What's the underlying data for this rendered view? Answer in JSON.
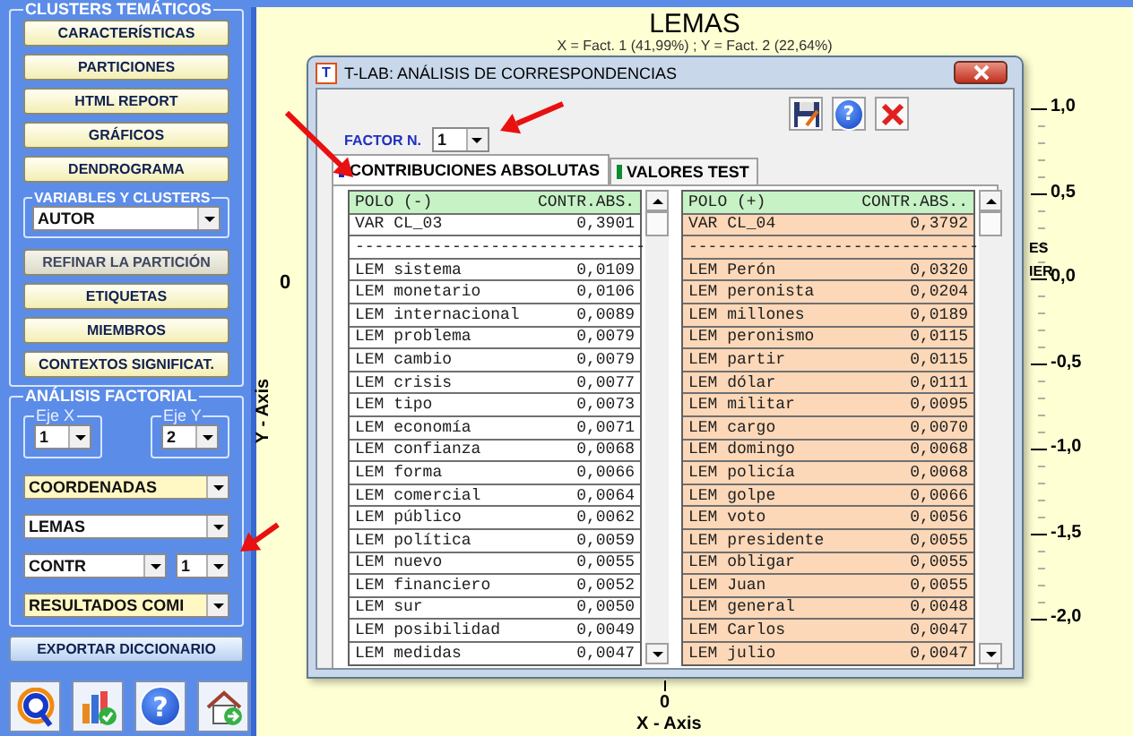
{
  "sidebar": {
    "clusters_group": {
      "title": "CLUSTERS TEMÁTICOS",
      "buttons": [
        {
          "label": "CARACTERÍSTICAS",
          "disabled": false
        },
        {
          "label": "PARTICIONES",
          "disabled": false
        },
        {
          "label": "HTML REPORT",
          "disabled": false
        },
        {
          "label": "GRÁFICOS",
          "disabled": false
        },
        {
          "label": "DENDROGRAMA",
          "disabled": false
        }
      ],
      "variables_group": {
        "title": "VARIABLES Y CLUSTERS",
        "value": "AUTOR"
      },
      "more_buttons": [
        {
          "label": "REFINAR LA PARTICIÓN",
          "disabled": true
        },
        {
          "label": "ETIQUETAS",
          "disabled": false
        },
        {
          "label": "MIEMBROS",
          "disabled": false
        },
        {
          "label": "CONTEXTOS SIGNIFICAT.",
          "disabled": false
        }
      ]
    },
    "factorial_group": {
      "title": "ANÁLISIS FACTORIAL",
      "axes": [
        {
          "label": "Eje X",
          "value": "1"
        },
        {
          "label": "Eje Y",
          "value": "2"
        }
      ],
      "dropdowns": [
        {
          "value": "COORDENADAS",
          "highlighted": true
        },
        {
          "value": "LEMAS",
          "highlighted": false
        },
        {
          "value": "CONTR",
          "highlighted": false,
          "factor": "1"
        },
        {
          "value": "RESULTADOS COMI",
          "highlighted": true
        }
      ]
    },
    "export_button": "EXPORTAR DICCIONARIO",
    "toolbar": [
      {
        "kind": "ring"
      },
      {
        "kind": "chart"
      },
      {
        "kind": "help",
        "glyph": "?"
      },
      {
        "kind": "home"
      }
    ]
  },
  "plot": {
    "title": "LEMAS",
    "subtitle": "X = Fact. 1 (41,99%) ; Y = Fact. 2 (22,64%)",
    "y_ticks": [
      "1,0",
      "0,5",
      "0,0",
      "-0,5",
      "-1,0",
      "-1,5",
      "-2,0"
    ],
    "y_origin": "0",
    "y_axis_label": "Y - Axis",
    "x_origin": "0",
    "x_axis_label": "X - Axis",
    "point_labels": [
      "ES",
      "IER"
    ]
  },
  "dialog": {
    "app_icon": "T",
    "title": "T-LAB: ANÁLISIS DE CORRESPONDENCIAS",
    "help_glyph": "?",
    "factor_label": "FACTOR N.",
    "factor_value": "1",
    "tabs": [
      {
        "label": "CONTRIBUCIONES ABSOLUTAS",
        "selected": true,
        "color": "#1028d8"
      },
      {
        "label": "VALORES TEST",
        "selected": false,
        "color": "#108a30"
      }
    ],
    "tables": [
      {
        "kind": "negative",
        "columns": [
          "POLO (-)",
          "CONTR.ABS."
        ],
        "rows": [
          {
            "label": "VAR CL_03",
            "value": "0,3901"
          },
          {
            "label": "------------------------------"
          },
          {
            "label": "LEM sistema",
            "value": "0,0109"
          },
          {
            "label": "LEM monetario",
            "value": "0,0106"
          },
          {
            "label": "LEM internacional",
            "value": "0,0089"
          },
          {
            "label": "LEM problema",
            "value": "0,0079"
          },
          {
            "label": "LEM cambio",
            "value": "0,0079"
          },
          {
            "label": "LEM crisis",
            "value": "0,0077"
          },
          {
            "label": "LEM tipo",
            "value": "0,0073"
          },
          {
            "label": "LEM economía",
            "value": "0,0071"
          },
          {
            "label": "LEM confianza",
            "value": "0,0068"
          },
          {
            "label": "LEM forma",
            "value": "0,0066"
          },
          {
            "label": "LEM comercial",
            "value": "0,0064"
          },
          {
            "label": "LEM público",
            "value": "0,0062"
          },
          {
            "label": "LEM política",
            "value": "0,0059"
          },
          {
            "label": "LEM nuevo",
            "value": "0,0055"
          },
          {
            "label": "LEM financiero",
            "value": "0,0052"
          },
          {
            "label": "LEM sur",
            "value": "0,0050"
          },
          {
            "label": "LEM posibilidad",
            "value": "0,0049"
          },
          {
            "label": "LEM medidas",
            "value": "0,0047"
          }
        ]
      },
      {
        "kind": "positive",
        "columns": [
          "POLO (+)",
          "CONTR.ABS.."
        ],
        "rows": [
          {
            "label": "VAR CL_04",
            "value": "0,3792"
          },
          {
            "label": "------------------------------"
          },
          {
            "label": "LEM Perón",
            "value": "0,0320"
          },
          {
            "label": "LEM peronista",
            "value": "0,0204"
          },
          {
            "label": "LEM millones",
            "value": "0,0189"
          },
          {
            "label": "LEM peronismo",
            "value": "0,0115"
          },
          {
            "label": "LEM partir",
            "value": "0,0115"
          },
          {
            "label": "LEM dólar",
            "value": "0,0111"
          },
          {
            "label": "LEM militar",
            "value": "0,0095"
          },
          {
            "label": "LEM cargo",
            "value": "0,0070"
          },
          {
            "label": "LEM domingo",
            "value": "0,0068"
          },
          {
            "label": "LEM policía",
            "value": "0,0068"
          },
          {
            "label": "LEM golpe",
            "value": "0,0066"
          },
          {
            "label": "LEM voto",
            "value": "0,0056"
          },
          {
            "label": "LEM presidente",
            "value": "0,0055"
          },
          {
            "label": "LEM obligar",
            "value": "0,0055"
          },
          {
            "label": "LEM Juan",
            "value": "0,0055"
          },
          {
            "label": "LEM general",
            "value": "0,0048"
          },
          {
            "label": "LEM Carlos",
            "value": "0,0047"
          },
          {
            "label": "LEM julio",
            "value": "0,0047"
          }
        ]
      }
    ]
  }
}
